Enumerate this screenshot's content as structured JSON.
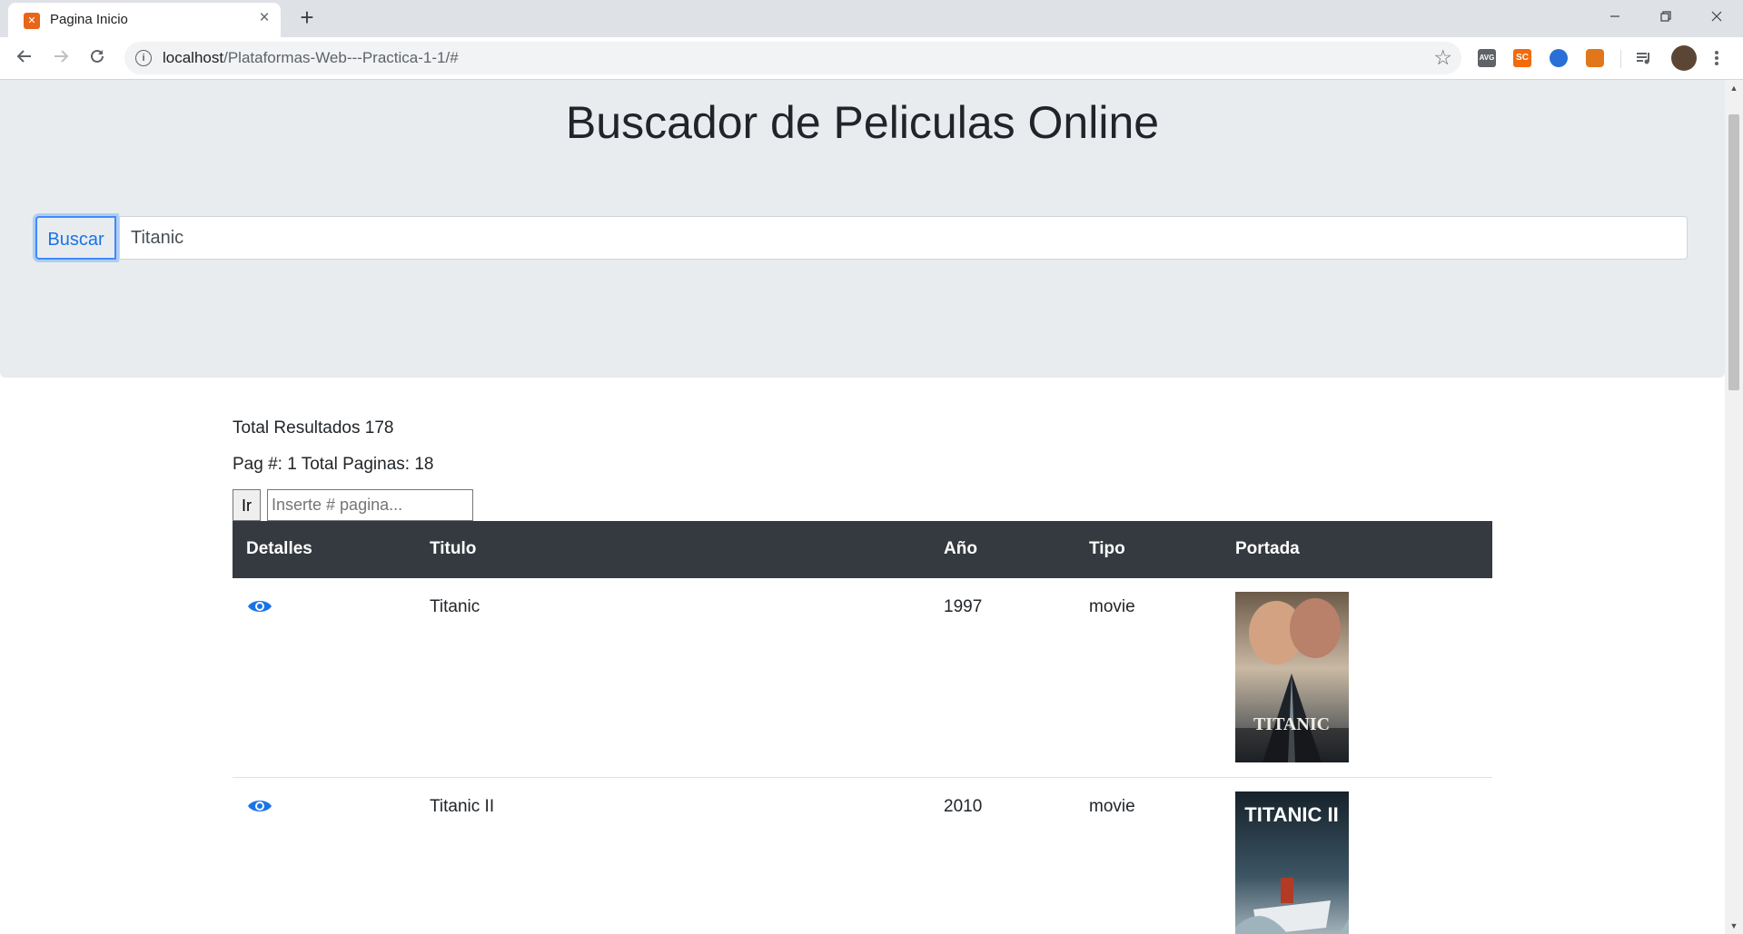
{
  "browser": {
    "tab_title": "Pagina Inicio",
    "tab_favicon": "xampp-icon",
    "tab_close": "×",
    "new_tab": "+",
    "url_host": "localhost",
    "url_path": "/Plataformas-Web---Practica-1-1/#",
    "extensions": [
      "avg-icon",
      "sc-icon",
      "refresh-ext-icon",
      "metamask-fox-icon",
      "media-queue-icon",
      "avatar",
      "menu-dots-icon"
    ],
    "ext_labels": {
      "avg": "AVG",
      "sc": "SC"
    }
  },
  "page": {
    "title": "Buscador de Peliculas Online",
    "search_button": "Buscar",
    "search_value": "Titanic",
    "total_results_label": "Total Resultados 178",
    "pagination_label": "Pag #: 1 Total Paginas: 18",
    "go_button": "Ir",
    "page_input_placeholder": "Inserte # pagina..."
  },
  "table": {
    "headers": [
      "Detalles",
      "Titulo",
      "Año",
      "Tipo",
      "Portada"
    ],
    "rows": [
      {
        "detail_icon": "eye-icon",
        "title": "Titanic",
        "year": "1997",
        "type": "movie",
        "poster_text": "TITANIC"
      },
      {
        "detail_icon": "eye-icon",
        "title": "Titanic II",
        "year": "2010",
        "type": "movie",
        "poster_text": "TITANIC II"
      }
    ]
  },
  "colors": {
    "accent": "#1a73e8",
    "jumbotron": "#e9ecef",
    "table_header": "#343a40"
  }
}
